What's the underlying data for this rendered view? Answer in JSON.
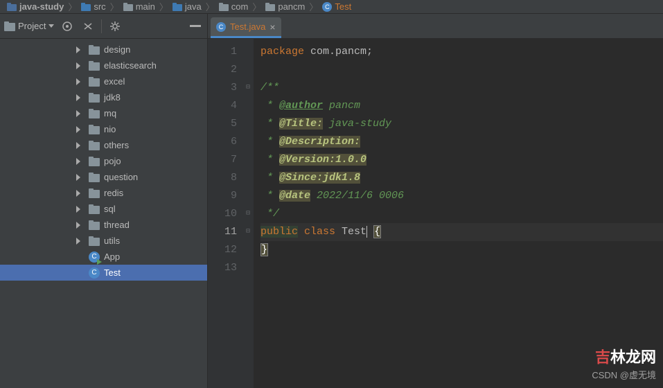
{
  "breadcrumb": [
    {
      "label": "java-study",
      "type": "module"
    },
    {
      "label": "src",
      "type": "folder-src"
    },
    {
      "label": "main",
      "type": "folder"
    },
    {
      "label": "java",
      "type": "folder-src"
    },
    {
      "label": "com",
      "type": "folder"
    },
    {
      "label": "pancm",
      "type": "folder"
    },
    {
      "label": "Test",
      "type": "class"
    }
  ],
  "toolbar": {
    "project_label": "Project"
  },
  "tree": [
    {
      "label": "design",
      "type": "folder"
    },
    {
      "label": "elasticsearch",
      "type": "folder"
    },
    {
      "label": "excel",
      "type": "folder"
    },
    {
      "label": "jdk8",
      "type": "folder"
    },
    {
      "label": "mq",
      "type": "folder"
    },
    {
      "label": "nio",
      "type": "folder"
    },
    {
      "label": "others",
      "type": "folder"
    },
    {
      "label": "pojo",
      "type": "folder"
    },
    {
      "label": "question",
      "type": "folder"
    },
    {
      "label": "redis",
      "type": "folder"
    },
    {
      "label": "sql",
      "type": "folder"
    },
    {
      "label": "thread",
      "type": "folder"
    },
    {
      "label": "utils",
      "type": "folder"
    },
    {
      "label": "App",
      "type": "class-run"
    },
    {
      "label": "Test",
      "type": "class",
      "selected": true
    }
  ],
  "tab": {
    "title": "Test.java"
  },
  "code": {
    "lines": [
      {
        "n": 1,
        "seg": [
          {
            "t": "package ",
            "c": "k-package"
          },
          {
            "t": "com.pancm;",
            "c": ""
          }
        ]
      },
      {
        "n": 2,
        "seg": []
      },
      {
        "n": 3,
        "fold": "⊟",
        "seg": [
          {
            "t": "/**",
            "c": "doc"
          }
        ]
      },
      {
        "n": 4,
        "seg": [
          {
            "t": " * ",
            "c": "doc"
          },
          {
            "t": "@author",
            "c": "doc-tag"
          },
          {
            "t": " pancm",
            "c": "doc"
          }
        ]
      },
      {
        "n": 5,
        "seg": [
          {
            "t": " * ",
            "c": "doc"
          },
          {
            "t": "@Title:",
            "c": "doc-tag-hl"
          },
          {
            "t": " java-study",
            "c": "doc"
          }
        ]
      },
      {
        "n": 6,
        "seg": [
          {
            "t": " * ",
            "c": "doc"
          },
          {
            "t": "@Description:",
            "c": "doc-tag-hl"
          }
        ]
      },
      {
        "n": 7,
        "seg": [
          {
            "t": " * ",
            "c": "doc"
          },
          {
            "t": "@Version:1.0.0",
            "c": "doc-tag-hl"
          }
        ]
      },
      {
        "n": 8,
        "seg": [
          {
            "t": " * ",
            "c": "doc"
          },
          {
            "t": "@Since:jdk1.8",
            "c": "doc-tag-hl"
          }
        ]
      },
      {
        "n": 9,
        "seg": [
          {
            "t": " * ",
            "c": "doc"
          },
          {
            "t": "@date",
            "c": "doc-tag-hl"
          },
          {
            "t": " 2022/11/6 0006",
            "c": "doc"
          }
        ]
      },
      {
        "n": 10,
        "fold": "⊟",
        "seg": [
          {
            "t": " */",
            "c": "doc"
          }
        ]
      },
      {
        "n": 11,
        "current": true,
        "fold": "⊟",
        "seg": [
          {
            "t": "public",
            "c": "k-public cls"
          },
          {
            "t": " ",
            "c": ""
          },
          {
            "t": "class ",
            "c": "k-class"
          },
          {
            "t": "Test",
            "c": "cursor"
          },
          {
            "t": " ",
            "c": ""
          },
          {
            "t": "{",
            "c": "brace-hl"
          }
        ]
      },
      {
        "n": 12,
        "seg": [
          {
            "t": "}",
            "c": "brace-hl"
          }
        ]
      },
      {
        "n": 13,
        "seg": []
      }
    ]
  },
  "watermark": {
    "site": "吉林龙网",
    "csdn": "CSDN @虚无境"
  }
}
